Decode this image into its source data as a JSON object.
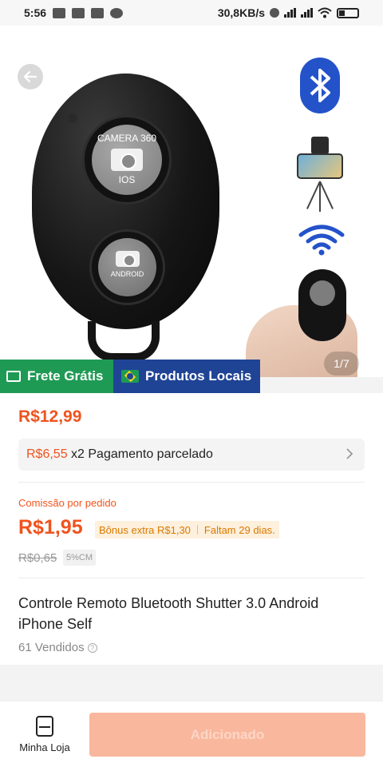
{
  "status_bar": {
    "time": "5:56",
    "network_speed": "30,8KB/s"
  },
  "gallery": {
    "page_indicator": "1/7",
    "remote_big_button_text_top": "CAMERA 360",
    "remote_big_button_text_bottom": "IOS",
    "remote_small_button_text": "ANDROID"
  },
  "badges": {
    "free_shipping": "Frete Grátis",
    "local_products": "Produtos Locais"
  },
  "product": {
    "price": "R$12,99",
    "installment_amount": "R$6,55",
    "installment_text": " x2 Pagamento parcelado",
    "commission_label": "Comissão por pedido",
    "commission_value": "R$1,95",
    "bonus_text": "Bônus extra R$1,30",
    "bonus_deadline": "Faltam 29 dias.",
    "old_commission": "R$0,65",
    "cm_tag": "5%CM",
    "title": "Controle Remoto Bluetooth Shutter 3.0 Android iPhone Self",
    "sold": "61 Vendidos"
  },
  "bottom_bar": {
    "shop_label": "Minha Loja",
    "add_label": "Adicionado"
  },
  "colors": {
    "accent": "#f0531e",
    "badge_green": "#1f9a55",
    "badge_blue": "#1f4495",
    "add_button": "#f9b79d"
  },
  "icons": [
    "back-arrow-icon",
    "bluetooth-icon",
    "wifi-icon",
    "truck-icon",
    "brazil-flag-icon",
    "chevron-right-icon",
    "question-icon",
    "shop-icon"
  ]
}
